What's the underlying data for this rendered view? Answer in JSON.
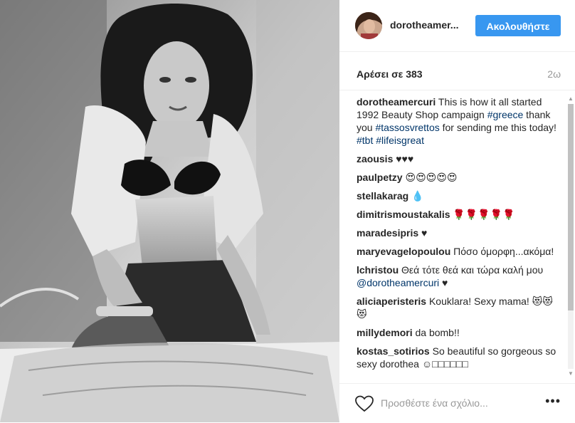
{
  "post_header": {
    "username": "dorotheamer...",
    "follow_label": "Ακολουθήστε"
  },
  "stats": {
    "likes": "Αρέσει σε 383",
    "time": "2ω"
  },
  "caption": {
    "user": "dorotheamercuri",
    "text_1": " This is how it all started 1992 Beauty Shop campaign ",
    "tag_1": "#greece",
    "text_2": " thank you ",
    "tag_2": "#tassosvrettos",
    "text_3": " for sending me this today! ",
    "tag_3": "#tbt",
    "text_4": " ",
    "tag_4": "#lifeisgreat"
  },
  "comments": [
    {
      "user": "zaousis",
      "text": " ♥♥♥"
    },
    {
      "user": "paulpetzy",
      "text": " 😍😍😍😍😍"
    },
    {
      "user": "stellakarag",
      "text": " 💧"
    },
    {
      "user": "dimitrismoustakalis",
      "text": " 🌹🌹🌹🌹🌹"
    },
    {
      "user": "maradesipris",
      "text": " ♥"
    },
    {
      "user": "maryevagelopoulou",
      "text": " Πόσο όμορφη...ακόμα!"
    },
    {
      "user": "lchristou",
      "text": " Θεά τότε θεά και τώρα καλή μου ",
      "tag": "@dorotheamercuri",
      "text_after": " ♥"
    },
    {
      "user": "aliciaperisteris",
      "text": " Kouklara! Sexy mama! 😻😻😻"
    },
    {
      "user": "millydemori",
      "text": " da bomb!!"
    },
    {
      "user": "kostas_sotirios",
      "text": " So beautiful so gorgeous so sexy dorothea ☺□□□□□□"
    }
  ],
  "footer": {
    "add_comment_placeholder": "Προσθέστε ένα σχόλιο...",
    "more_label": "•••"
  },
  "icons": {
    "heart": "heart-icon",
    "more": "more-options-icon",
    "scroll_up": "scroll-up-arrow-icon",
    "scroll_down": "scroll-down-arrow-icon"
  },
  "colors": {
    "follow_button": "#3897f0",
    "hashtag": "#003569",
    "secondary_text": "#999999"
  }
}
